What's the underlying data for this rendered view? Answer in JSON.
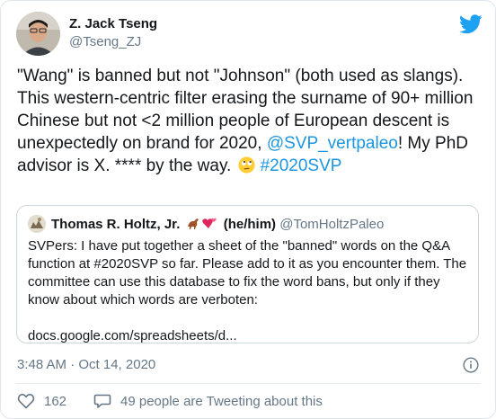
{
  "author": {
    "name": "Z. Jack Tseng",
    "handle": "@Tseng_ZJ"
  },
  "tweet": {
    "text_before": "\"Wang\" is banned but not \"Johnson\" (both used as slangs). This western-centric filter erasing the surname of 90+ million Chinese but not <2 million people of European descent is unexpectedly on brand for 2020, ",
    "mention": "@SVP_vertpaleo",
    "text_after": "! My PhD advisor is X. **** by the way. ",
    "hashtag": "#2020SVP"
  },
  "quoted": {
    "name": "Thomas R. Holtz, Jr.",
    "pronouns": "(he/him)",
    "handle": "@TomHoltzPaleo",
    "text": "SVPers: I have put together a sheet of the \"banned\" words on the Q&A function at #2020SVP so far. Please add to it as you encounter them. The committee can use this database to fix the word bans, but only if they know about which words are verboten:",
    "link": "docs.google.com/spreadsheets/d..."
  },
  "timestamp": "3:48 AM · Oct 14, 2020",
  "actions": {
    "likes": "162",
    "conversation": "49 people are Tweeting about this"
  },
  "colors": {
    "link": "#1b95e0",
    "secondary_text": "#657786",
    "twitter_blue": "#1da1f2"
  },
  "icons": [
    "twitter-bird-icon",
    "info-icon",
    "heart-icon",
    "speech-bubble-icon",
    "dinosaur-emoji-icon",
    "two-hearts-emoji-icon",
    "rolling-eyes-emoji-icon"
  ]
}
